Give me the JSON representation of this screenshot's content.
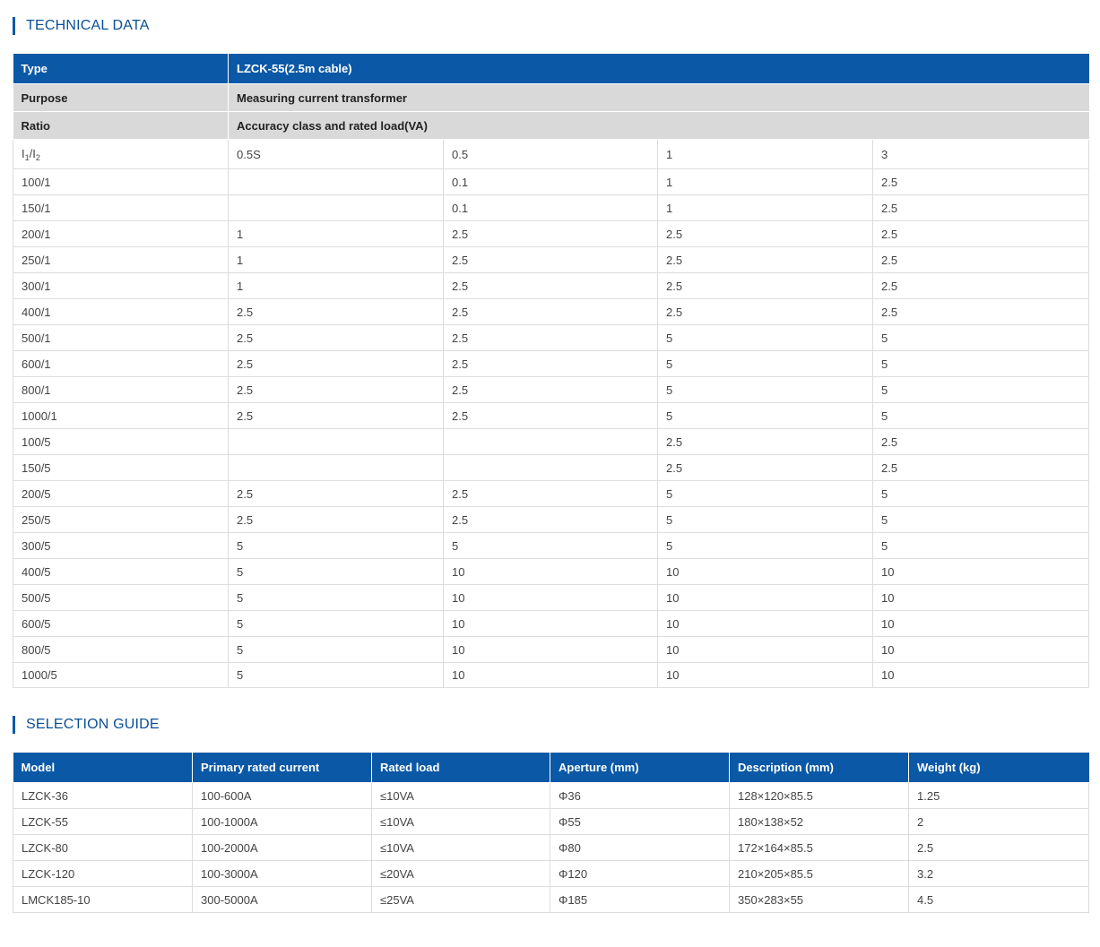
{
  "technical_data": {
    "title": "TECHNICAL DATA",
    "type_label": "Type",
    "type_value": "LZCK-55(2.5m cable)",
    "purpose_label": "Purpose",
    "purpose_value": "Measuring current transformer",
    "ratio_label": "Ratio",
    "ratio_value": "Accuracy class and rated load(VA)",
    "sub_header": {
      "i_letter_1": "I",
      "i_sub_1": "1",
      "slash": "/",
      "i_letter_2": "I",
      "i_sub_2": "2",
      "classes": [
        "0.5S",
        "0.5",
        "1",
        "3"
      ]
    },
    "rows": [
      [
        "100/1",
        "",
        "0.1",
        "1",
        "2.5"
      ],
      [
        "150/1",
        "",
        "0.1",
        "1",
        "2.5"
      ],
      [
        "200/1",
        "1",
        "2.5",
        "2.5",
        "2.5"
      ],
      [
        "250/1",
        "1",
        "2.5",
        "2.5",
        "2.5"
      ],
      [
        "300/1",
        "1",
        "2.5",
        "2.5",
        "2.5"
      ],
      [
        "400/1",
        "2.5",
        "2.5",
        "2.5",
        "2.5"
      ],
      [
        "500/1",
        "2.5",
        "2.5",
        "5",
        "5"
      ],
      [
        "600/1",
        "2.5",
        "2.5",
        "5",
        "5"
      ],
      [
        "800/1",
        "2.5",
        "2.5",
        "5",
        "5"
      ],
      [
        "1000/1",
        "2.5",
        "2.5",
        "5",
        "5"
      ],
      [
        "100/5",
        "",
        "",
        "2.5",
        "2.5"
      ],
      [
        "150/5",
        "",
        "",
        "2.5",
        "2.5"
      ],
      [
        "200/5",
        "2.5",
        "2.5",
        "5",
        "5"
      ],
      [
        "250/5",
        "2.5",
        "2.5",
        "5",
        "5"
      ],
      [
        "300/5",
        "5",
        "5",
        "5",
        "5"
      ],
      [
        "400/5",
        "5",
        "10",
        "10",
        "10"
      ],
      [
        "500/5",
        "5",
        "10",
        "10",
        "10"
      ],
      [
        "600/5",
        "5",
        "10",
        "10",
        "10"
      ],
      [
        "800/5",
        "5",
        "10",
        "10",
        "10"
      ],
      [
        "1000/5",
        "5",
        "10",
        "10",
        "10"
      ]
    ]
  },
  "selection_guide": {
    "title": "SELECTION GUIDE",
    "headers": [
      "Model",
      "Primary rated current",
      "Rated load",
      "Aperture (mm)",
      "Description (mm)",
      "Weight (kg)"
    ],
    "rows": [
      [
        "LZCK-36",
        "100-600A",
        "≤10VA",
        "Φ36",
        "128×120×85.5",
        "1.25"
      ],
      [
        "LZCK-55",
        "100-1000A",
        "≤10VA",
        "Φ55",
        "180×138×52",
        "2"
      ],
      [
        "LZCK-80",
        "100-2000A",
        "≤10VA",
        "Φ80",
        "172×164×85.5",
        "2.5"
      ],
      [
        "LZCK-120",
        "100-3000A",
        "≤20VA",
        "Φ120",
        "210×205×85.5",
        "3.2"
      ],
      [
        "LMCK185-10",
        "300-5000A",
        "≤25VA",
        "Φ185",
        "350×283×55",
        "4.5"
      ]
    ]
  },
  "colors": {
    "header_blue": "#0a58a6",
    "section_title": "#0a4f96",
    "gray_row": "#d9d9d9",
    "border": "#dcdcdc"
  }
}
